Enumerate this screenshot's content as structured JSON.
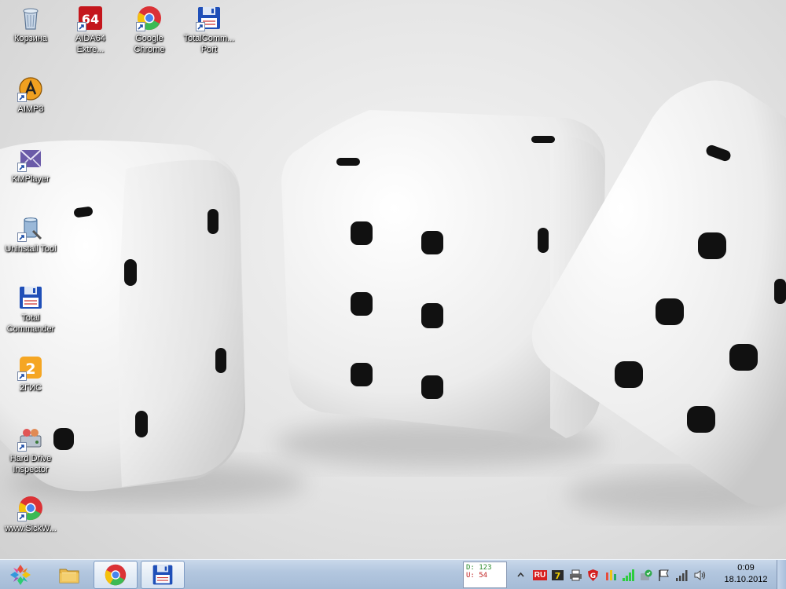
{
  "desktop": {
    "icons": [
      {
        "label": "Корзина",
        "icon": "recycle-bin-icon"
      },
      {
        "label": "AIDA64\nExtre...",
        "icon": "aida64-icon"
      },
      {
        "label": "Google\nChrome",
        "icon": "chrome-icon"
      },
      {
        "label": "TotalComm...\nPort",
        "icon": "floppy-icon"
      },
      {
        "label": "AIMP3",
        "icon": "aimp-icon"
      },
      {
        "label": "KMPlayer",
        "icon": "kmplayer-icon"
      },
      {
        "label": "Uninstall Tool",
        "icon": "uninstall-tool-icon"
      },
      {
        "label": "Total\nCommander",
        "icon": "floppy-icon"
      },
      {
        "label": "2ГИС",
        "icon": "2gis-icon"
      },
      {
        "label": "Hard Drive\nInspector",
        "icon": "hard-drive-inspector-icon"
      },
      {
        "label": "www.SickW...",
        "icon": "chrome-icon"
      }
    ]
  },
  "taskbar": {
    "start_icon": "windows-logo-icon",
    "buttons": [
      {
        "name": "explorer",
        "icon": "folder-icon"
      },
      {
        "name": "chrome",
        "icon": "chrome-icon"
      },
      {
        "name": "total-commander",
        "icon": "floppy-icon"
      }
    ],
    "net_meter": {
      "down": "D: 123",
      "up": "U: 54"
    },
    "tray": {
      "language": "RU",
      "icons": [
        "chevron-icon",
        "language-icon",
        "app-icon",
        "printer-icon",
        "shield-icon",
        "bars-icon",
        "signal-icon",
        "antivirus-icon",
        "flag-icon",
        "network-icon",
        "volume-icon"
      ]
    },
    "clock": {
      "time": "0:09",
      "date": "18.10.2012"
    }
  },
  "colors": {
    "taskbar_top": "#c9d8ea",
    "taskbar_bottom": "#a5bbd6",
    "lang_bg": "#d62020"
  }
}
